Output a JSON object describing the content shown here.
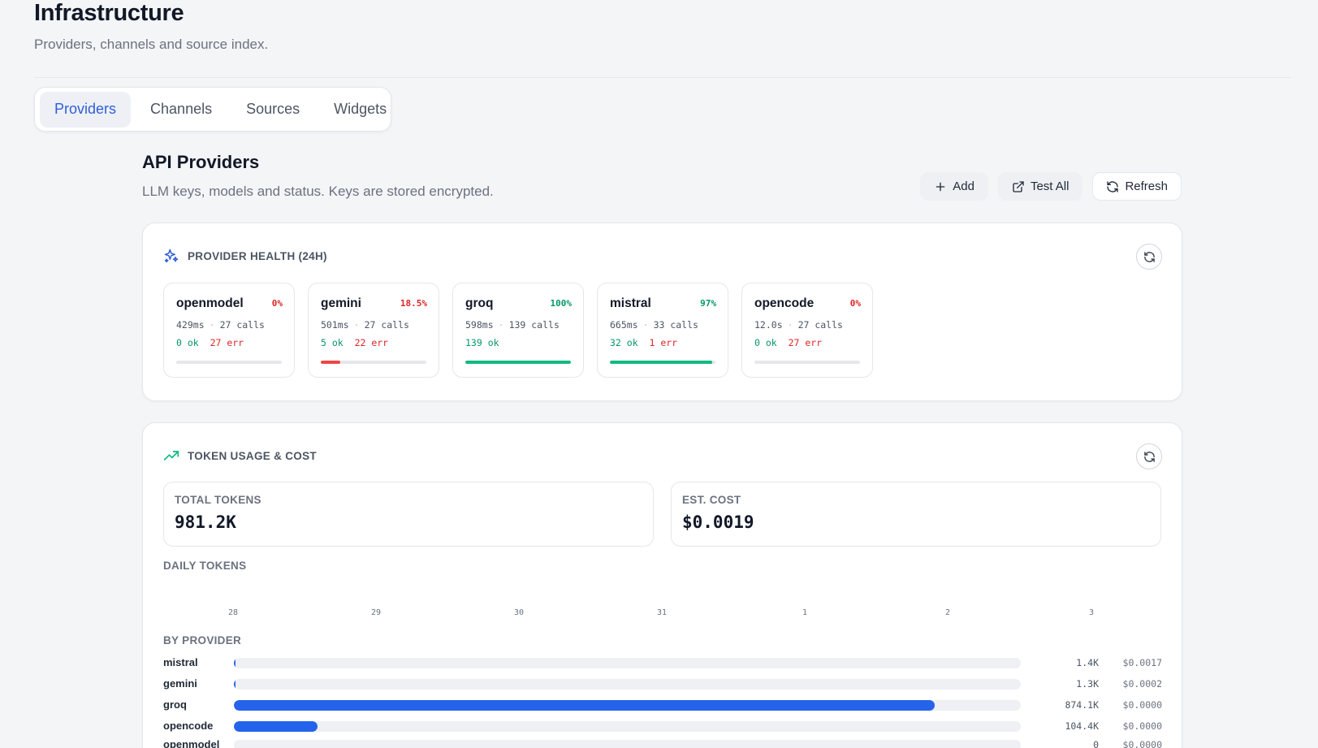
{
  "page": {
    "title": "Infrastructure",
    "subtitle": "Providers, channels and source index."
  },
  "tabs": [
    {
      "label": "Providers",
      "active": true
    },
    {
      "label": "Channels",
      "active": false
    },
    {
      "label": "Sources",
      "active": false
    },
    {
      "label": "Widgets",
      "active": false
    }
  ],
  "section": {
    "title": "API Providers",
    "subtitle": "LLM keys, models and status. Keys are stored encrypted."
  },
  "actions": {
    "add_label": "Add",
    "test_all_label": "Test All",
    "refresh_label": "Refresh"
  },
  "health": {
    "title": "PROVIDER HEALTH (24H)",
    "icon": "sparkles-icon",
    "providers": [
      {
        "name": "openmodel",
        "pct": "0%",
        "latency": "429ms",
        "calls": "27 calls",
        "ok": "0 ok",
        "err": "27 err",
        "success_rate": 0
      },
      {
        "name": "gemini",
        "pct": "18.5%",
        "latency": "501ms",
        "calls": "27 calls",
        "ok": "5 ok",
        "err": "22 err",
        "success_rate": 0.185
      },
      {
        "name": "groq",
        "pct": "100%",
        "latency": "598ms",
        "calls": "139 calls",
        "ok": "139 ok",
        "err": "",
        "success_rate": 1.0
      },
      {
        "name": "mistral",
        "pct": "97%",
        "latency": "665ms",
        "calls": "33 calls",
        "ok": "32 ok",
        "err": "1 err",
        "success_rate": 0.97
      },
      {
        "name": "opencode",
        "pct": "0%",
        "latency": "12.0s",
        "calls": "27 calls",
        "ok": "0 ok",
        "err": "27 err",
        "success_rate": 0
      }
    ]
  },
  "usage": {
    "title": "TOKEN USAGE & COST",
    "icon": "trending-up-icon",
    "total_tokens_label": "TOTAL TOKENS",
    "total_tokens": "981.2K",
    "est_cost_label": "EST. COST",
    "est_cost": "$0.0019",
    "daily_label": "DAILY TOKENS",
    "days": [
      "28",
      "29",
      "30",
      "31",
      "1",
      "2",
      "3"
    ],
    "by_provider_label": "BY PROVIDER",
    "by_provider": [
      {
        "name": "mistral",
        "tokens": "1.4K",
        "cost": "$0.0017",
        "share": 0.0014
      },
      {
        "name": "gemini",
        "tokens": "1.3K",
        "cost": "$0.0002",
        "share": 0.0013
      },
      {
        "name": "groq",
        "tokens": "874.1K",
        "cost": "$0.0000",
        "share": 0.891
      },
      {
        "name": "opencode",
        "tokens": "104.4K",
        "cost": "$0.0000",
        "share": 0.106
      },
      {
        "name": "openmodel",
        "tokens": "0",
        "cost": "$0.0000",
        "share": 0
      }
    ]
  },
  "colors": {
    "accent": "#2f5fd8",
    "ok": "#059669",
    "err": "#dc2626",
    "bar_ok": "#10b981",
    "bar_err": "#ef4444",
    "bar_blue": "#2563eb"
  }
}
